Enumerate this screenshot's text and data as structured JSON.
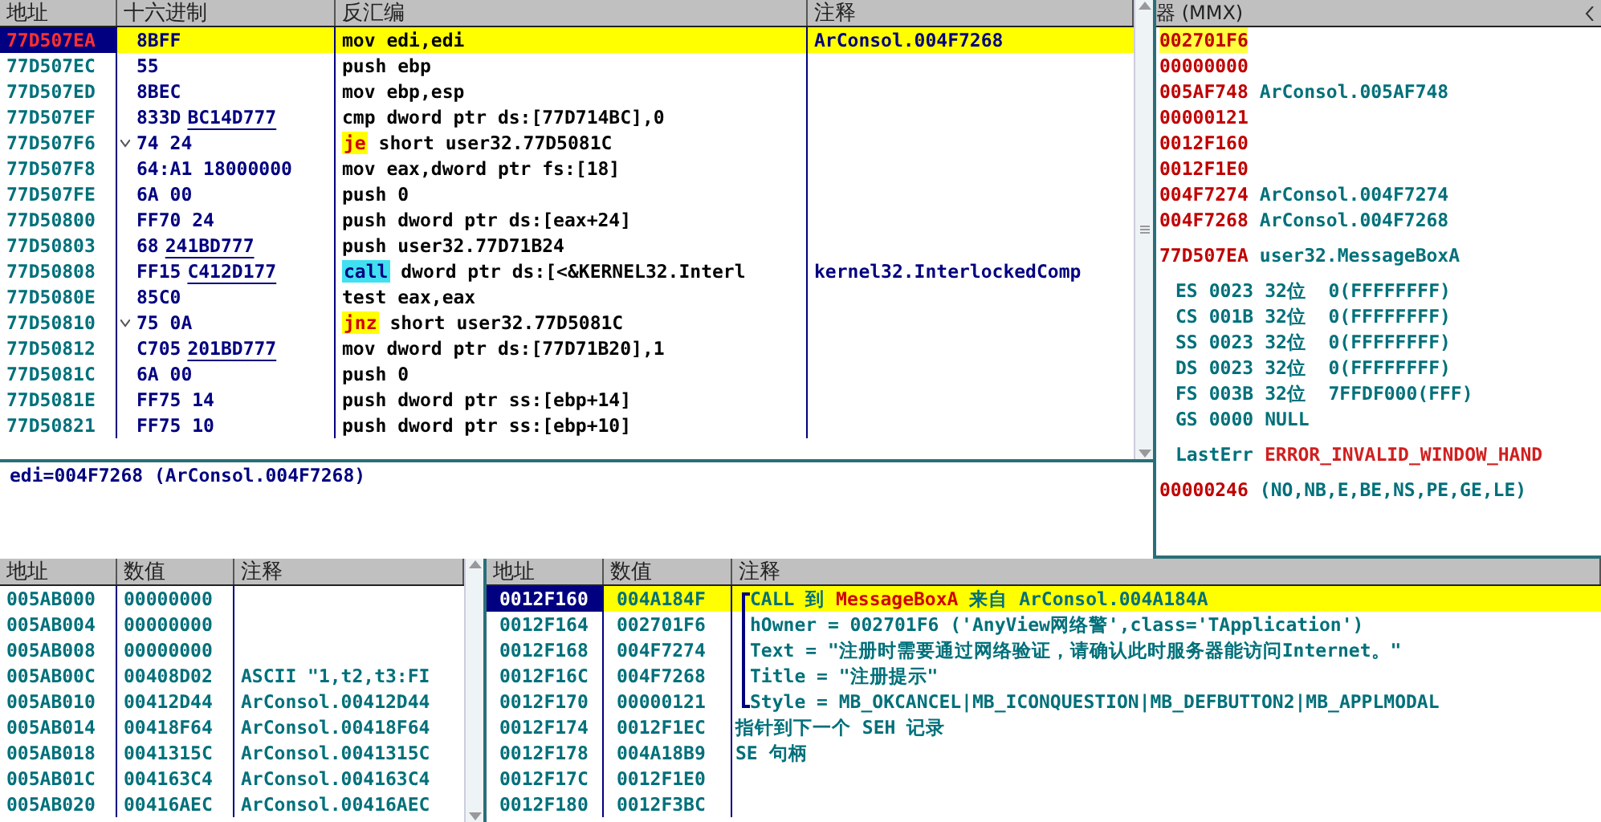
{
  "disassembly": {
    "columns": [
      "地址",
      "十六进制",
      "反汇编",
      "注释"
    ],
    "rows": [
      {
        "kind": "plain",
        "address": "77D507EA",
        "hex": "8BFF",
        "mnemonic": "mov",
        "operands": "edi,edi",
        "comment": "ArConsol.004F7268",
        "selected": true
      },
      {
        "kind": "plain",
        "address": "77D507EC",
        "hex": "55",
        "mnemonic": "push",
        "operands": "ebp",
        "selected": false
      },
      {
        "kind": "plain",
        "address": "77D507ED",
        "hex": "8BEC",
        "mnemonic": "mov",
        "operands": "ebp,esp",
        "selected": false
      },
      {
        "kind": "plain",
        "address": "77D507EF",
        "hex": "833D",
        "hex_operand": "BC14D777",
        "mnemonic": "cmp",
        "operands": "dword ptr ds:[77D714BC],0",
        "selected": false
      },
      {
        "kind": "jump",
        "address": "77D507F6",
        "hex": "74 24",
        "jump_mark": true,
        "mnemonic": "je",
        "operands": "short user32.77D5081C",
        "selected": false
      },
      {
        "kind": "plain",
        "address": "77D507F8",
        "hex": "64:A1 18000000",
        "mnemonic": "mov",
        "operands": "eax,dword ptr fs:[18]",
        "selected": false
      },
      {
        "kind": "plain",
        "address": "77D507FE",
        "hex": "6A 00",
        "mnemonic": "push",
        "operands": "0",
        "selected": false
      },
      {
        "kind": "plain",
        "address": "77D50800",
        "hex": "FF70 24",
        "mnemonic": "push",
        "operands": "dword ptr ds:[eax+24]",
        "selected": false
      },
      {
        "kind": "plain",
        "address": "77D50803",
        "hex": "68",
        "hex_operand": "241BD777",
        "mnemonic": "push",
        "operands": "user32.77D71B24",
        "selected": false
      },
      {
        "kind": "call",
        "address": "77D50808",
        "hex": "FF15",
        "hex_operand": "C412D177",
        "mnemonic": "call",
        "operands": "dword ptr ds:[<&KERNEL32.Interl",
        "comment": "kernel32.InterlockedComp",
        "selected": false
      },
      {
        "kind": "plain",
        "address": "77D5080E",
        "hex": "85C0",
        "mnemonic": "test",
        "operands": "eax,eax",
        "selected": false
      },
      {
        "kind": "jump",
        "address": "77D50810",
        "hex": "75 0A",
        "jump_mark": true,
        "mnemonic": "jnz",
        "operands": "short user32.77D5081C",
        "selected": false
      },
      {
        "kind": "plain",
        "address": "77D50812",
        "hex": "C705",
        "hex_operand": "201BD777",
        "mnemonic": "mov",
        "operands": "dword ptr ds:[77D71B20],1",
        "selected": false
      },
      {
        "kind": "plain",
        "address": "77D5081C",
        "hex": "6A 00",
        "mnemonic": "push",
        "operands": "0",
        "selected": false
      },
      {
        "kind": "plain",
        "address": "77D5081E",
        "hex": "FF75 14",
        "mnemonic": "push",
        "operands": "dword ptr ss:[ebp+14]",
        "selected": false
      },
      {
        "kind": "plain",
        "address": "77D50821",
        "hex": "FF75 10",
        "mnemonic": "push",
        "operands": "dword ptr ss:[ebp+10]",
        "selected": false
      }
    ]
  },
  "info": "edi=004F7268 (ArConsol.004F7268)",
  "registers": {
    "title": "器 (MMX)",
    "groups": [
      {
        "rows": [
          {
            "kind": "value",
            "value": "002701F6",
            "changed": true
          },
          {
            "kind": "value",
            "value": "00000000",
            "changed": false
          },
          {
            "kind": "value",
            "value": "005AF748",
            "note": "ArConsol.005AF748",
            "changed": false
          },
          {
            "kind": "value",
            "value": "00000121",
            "changed": false
          },
          {
            "kind": "value",
            "value": "0012F160",
            "changed": false
          },
          {
            "kind": "value",
            "value": "0012F1E0",
            "changed": false
          },
          {
            "kind": "value",
            "value": "004F7274",
            "note": "ArConsol.004F7274",
            "changed": false
          },
          {
            "kind": "value",
            "value": "004F7268",
            "note": "ArConsol.004F7268",
            "changed": false
          }
        ]
      },
      {
        "rows": [
          {
            "kind": "value",
            "value": "77D507EA",
            "note": "user32.MessageBoxA",
            "changed": false
          }
        ]
      },
      {
        "rows": [
          {
            "kind": "segment",
            "name": "ES",
            "value": "0023",
            "note": "32位  0(FFFFFFFF)"
          },
          {
            "kind": "segment",
            "name": "CS",
            "value": "001B",
            "note": "32位  0(FFFFFFFF)"
          },
          {
            "kind": "segment",
            "name": "SS",
            "value": "0023",
            "note": "32位  0(FFFFFFFF)"
          },
          {
            "kind": "segment",
            "name": "DS",
            "value": "0023",
            "note": "32位  0(FFFFFFFF)"
          },
          {
            "kind": "segment",
            "name": "FS",
            "value": "003B",
            "note": "32位  7FFDF000(FFF)"
          },
          {
            "kind": "segment",
            "name": "GS",
            "value": "0000",
            "note": "NULL"
          }
        ]
      },
      {
        "rows": [
          {
            "kind": "error",
            "name": "LastErr",
            "value": "ERROR_INVALID_WINDOW_HAND"
          }
        ]
      },
      {
        "rows": [
          {
            "kind": "value",
            "value": "00000246",
            "note": "(NO,NB,E,BE,NS,PE,GE,LE)",
            "changed": false
          }
        ]
      }
    ]
  },
  "dump": {
    "columns": [
      "地址",
      "数值",
      "注释"
    ],
    "rows": [
      {
        "address": "005AB000",
        "value": "00000000"
      },
      {
        "address": "005AB004",
        "value": "00000000"
      },
      {
        "address": "005AB008",
        "value": "00000000"
      },
      {
        "address": "005AB00C",
        "value": "00408D02",
        "comment": "ASCII \"1,t2,t3:FI"
      },
      {
        "address": "005AB010",
        "value": "00412D44",
        "comment": "ArConsol.00412D44"
      },
      {
        "address": "005AB014",
        "value": "00418F64",
        "comment": "ArConsol.00418F64"
      },
      {
        "address": "005AB018",
        "value": "0041315C",
        "comment": "ArConsol.0041315C"
      },
      {
        "address": "005AB01C",
        "value": "004163C4",
        "comment": "ArConsol.004163C4"
      },
      {
        "address": "005AB020",
        "value": "00416AEC",
        "comment": "ArConsol.00416AEC"
      }
    ]
  },
  "stack": {
    "columns": [
      "地址",
      "数值",
      "注释"
    ],
    "rows": [
      {
        "kind": "call_start",
        "address": "0012F160",
        "value": "004A184F",
        "selected": true,
        "comment": [
          {
            "text": "CALL 到 ",
            "kind": "plain"
          },
          {
            "text": "MessageBoxA",
            "kind": "api"
          },
          {
            "text": " 来自 ArConsol.004A184A",
            "kind": "plain"
          }
        ]
      },
      {
        "kind": "call_arg",
        "address": "0012F164",
        "value": "002701F6",
        "selected": false,
        "comment": [
          {
            "text": "hOwner = 002701F6 ('AnyView网络警',class='TApplication')",
            "kind": "plain"
          }
        ]
      },
      {
        "kind": "call_arg",
        "address": "0012F168",
        "value": "004F7274",
        "selected": false,
        "comment": [
          {
            "text": "Text = \"注册时需要通过网络验证，请确认此时服务器能访问Internet。\"",
            "kind": "plain"
          }
        ]
      },
      {
        "kind": "call_arg",
        "address": "0012F16C",
        "value": "004F7268",
        "selected": false,
        "comment": [
          {
            "text": "Title = \"注册提示\"",
            "kind": "plain"
          }
        ]
      },
      {
        "kind": "call_end",
        "address": "0012F170",
        "value": "00000121",
        "selected": false,
        "comment": [
          {
            "text": "Style = MB_OKCANCEL|MB_ICONQUESTION|MB_DEFBUTTON2|MB_APPLMODAL",
            "kind": "plain"
          }
        ]
      },
      {
        "kind": "plain",
        "address": "0012F174",
        "value": "0012F1EC",
        "selected": false,
        "comment": [
          {
            "text": "指针到下一个 SEH 记录",
            "kind": "plain"
          }
        ]
      },
      {
        "kind": "plain",
        "address": "0012F178",
        "value": "004A18B9",
        "selected": false,
        "comment": [
          {
            "text": "SE 句柄",
            "kind": "plain"
          }
        ]
      },
      {
        "kind": "plain",
        "address": "0012F17C",
        "value": "0012F1E0",
        "selected": false
      },
      {
        "kind": "plain",
        "address": "0012F180",
        "value": "0012F3BC",
        "selected": false
      }
    ]
  }
}
